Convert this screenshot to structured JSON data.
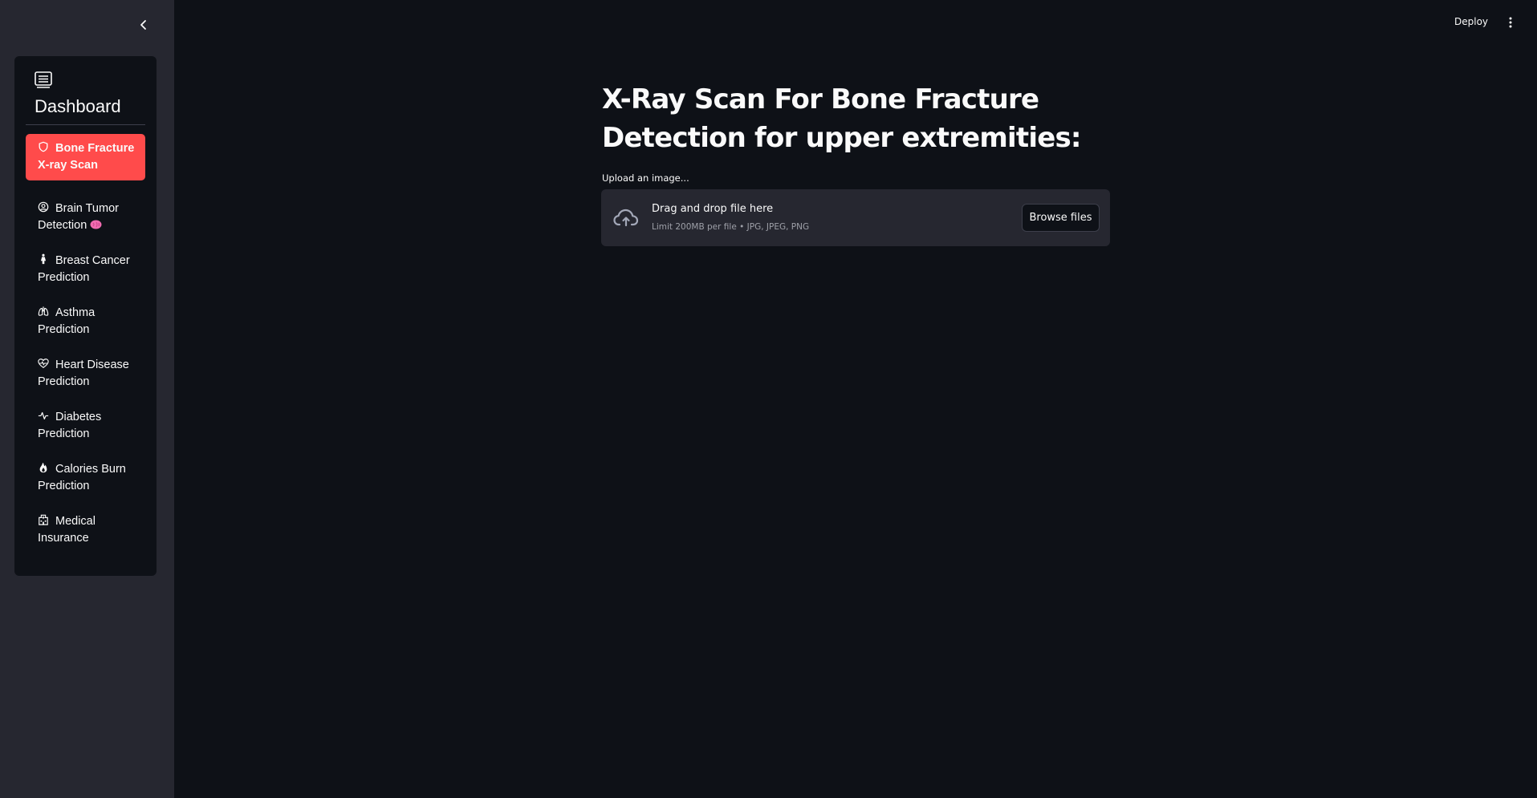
{
  "sidebar": {
    "collapse_icon": "chevron-left-icon",
    "menu": {
      "header_icon": "list-card-icon",
      "title": "Dashboard",
      "items": [
        {
          "icon": "shield-icon",
          "label": "Bone Fracture X-ray Scan",
          "active": true
        },
        {
          "icon": "person-circle-icon",
          "label": "Brain Tumor Detection",
          "emoji": "brain-emoji"
        },
        {
          "icon": "person-standing-dress-icon",
          "label": "Breast Cancer Prediction"
        },
        {
          "icon": "lungs-icon",
          "label": "Asthma Prediction"
        },
        {
          "icon": "heart-pulse-icon",
          "label": "Heart Disease Prediction"
        },
        {
          "icon": "activity-icon",
          "label": "Diabetes Prediction"
        },
        {
          "icon": "fire-icon",
          "label": "Calories Burn Prediction"
        },
        {
          "icon": "hospital-icon",
          "label": "Medical Insurance"
        }
      ]
    }
  },
  "topbar": {
    "deploy_label": "Deploy",
    "menu_icon": "three-dots-vertical-icon"
  },
  "main": {
    "title_line1": "X-Ray Scan For Bone Fracture",
    "title_line2": "Detection for upper extremities:",
    "uploader": {
      "label": "Upload an image...",
      "icon": "cloud-upload-icon",
      "primary_text": "Drag and drop file here",
      "secondary_text": "Limit 200MB per file • JPG, JPEG, PNG",
      "button_label": "Browse files"
    }
  },
  "colors": {
    "background": "#0e1117",
    "sidebar": "#262730",
    "accent": "#ff4b4b",
    "text": "#fafafa",
    "muted_text": "#9ea0a8"
  }
}
